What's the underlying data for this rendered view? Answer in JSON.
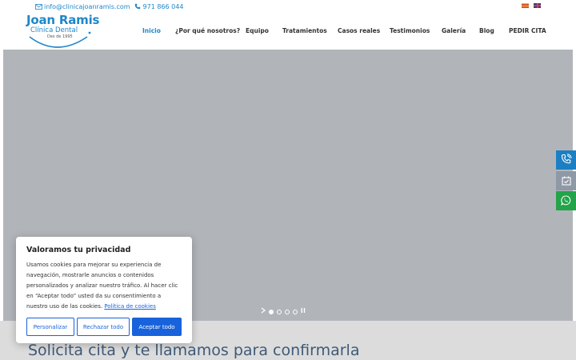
{
  "topbar": {
    "email": "info@clinicajoanramis.com",
    "phone": "971 866 044",
    "languages": [
      "ca",
      "en"
    ]
  },
  "logo": {
    "name": "Joan Ramis",
    "subtitle": "Clínica Dental",
    "since": "Des de 1995"
  },
  "nav": {
    "items": [
      {
        "label": "Inicio",
        "active": true
      },
      {
        "label": "¿Por qué nosotros?",
        "active": false
      },
      {
        "label": "Equipo",
        "active": false
      },
      {
        "label": "Tratamientos",
        "active": false
      },
      {
        "label": "Casos reales",
        "active": false
      },
      {
        "label": "Testimonios",
        "active": false
      },
      {
        "label": "Galería",
        "active": false
      },
      {
        "label": "Blog",
        "active": false
      },
      {
        "label": "PEDIR CITA",
        "active": false
      }
    ]
  },
  "slider": {
    "slides": 4,
    "current": 1
  },
  "side_buttons": [
    "phone-icon",
    "calendar-icon",
    "whatsapp-icon"
  ],
  "cta": {
    "title": "Solicita cita y te llamamos para confirmarla"
  },
  "cookie": {
    "title": "Valoramos tu privacidad",
    "body": "Usamos cookies para mejorar su experiencia de navegación, mostrarle anuncios o contenidos personalizados y analizar nuestro tráfico. Al hacer clic en “Aceptar todo” usted da su consentimiento a nuestro uso de las cookies.",
    "policy_link": "Política de cookies",
    "buttons": {
      "customize": "Personalizar",
      "reject": "Rechazar todo",
      "accept": "Aceptar todo"
    }
  },
  "colors": {
    "brand": "#1f86c8",
    "hero_bg": "#b1b5ba",
    "cookie_accent": "#1863dc",
    "whatsapp": "#23a34a"
  }
}
